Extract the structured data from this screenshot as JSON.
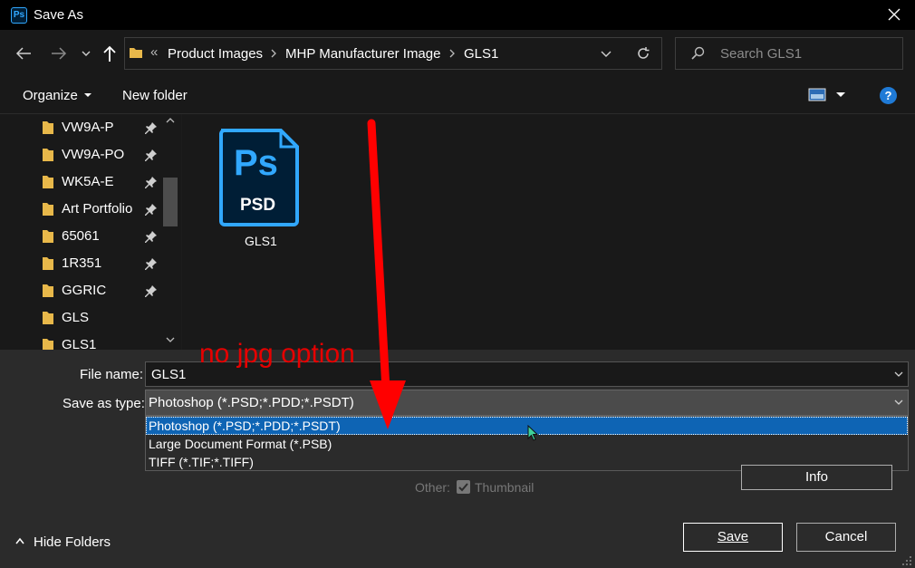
{
  "window": {
    "app_badge": "Ps",
    "title": "Save As"
  },
  "breadcrumb": {
    "overflow": "«",
    "items": [
      "Product Images",
      "MHP Manufacturer Image",
      "GLS1"
    ]
  },
  "search": {
    "placeholder": "Search GLS1"
  },
  "toolbar": {
    "organize_label": "Organize",
    "new_folder_label": "New folder",
    "help_label": "?"
  },
  "sidebar": {
    "items": [
      {
        "label": "VW9A-P",
        "pinned": true
      },
      {
        "label": "VW9A-PO",
        "pinned": true
      },
      {
        "label": "WK5A-E",
        "pinned": true
      },
      {
        "label": "Art Portfolio",
        "pinned": true
      },
      {
        "label": "65061",
        "pinned": true
      },
      {
        "label": "1R351",
        "pinned": true
      },
      {
        "label": "GGRIC",
        "pinned": true
      },
      {
        "label": "GLS",
        "pinned": false
      },
      {
        "label": "GLS1",
        "pinned": false
      }
    ]
  },
  "files": [
    {
      "name": "GLS1",
      "icon_text_top": "Ps",
      "icon_text_bottom": "PSD"
    }
  ],
  "form": {
    "filename_label": "File name:",
    "filename_value": "GLS1",
    "type_label": "Save as type:",
    "type_value": "Photoshop (*.PSD;*.PDD;*.PSDT)",
    "type_options": [
      "Photoshop (*.PSD;*.PDD;*.PSDT)",
      "Large Document Format (*.PSB)",
      "TIFF (*.TIF;*.TIFF)"
    ],
    "selected_index": 0
  },
  "options": {
    "other_label": "Other:",
    "thumbnail_label": "Thumbnail",
    "thumbnail_checked": true,
    "info_label": "Info"
  },
  "footer": {
    "hide_folders_label": "Hide Folders",
    "save_label": "Save",
    "cancel_label": "Cancel"
  },
  "annotation": {
    "text": "no jpg option",
    "color": "#e60000"
  },
  "colors": {
    "accent": "#0e64b4",
    "folder": "#e8b84a",
    "ps_blue": "#31a8ff",
    "ps_bg": "#001e36"
  }
}
